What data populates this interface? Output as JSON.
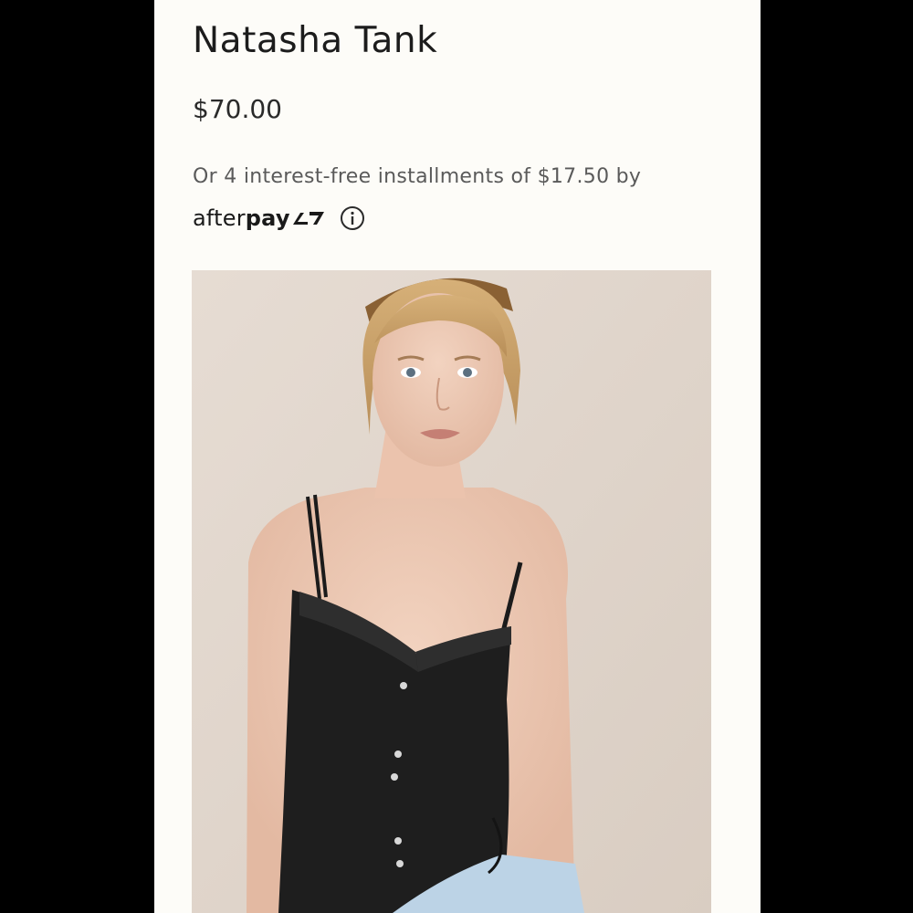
{
  "product": {
    "title": "Natasha Tank",
    "price": "$70.00",
    "installments_text": "Or 4 interest-free installments of $17.50 by",
    "afterpay": {
      "logo_light": "after",
      "logo_bold": "pay",
      "arrows_icon": "afterpay-arrows-icon",
      "info_icon": "info-circle-icon"
    },
    "image": {
      "description_icon": "product-photo"
    }
  },
  "colors": {
    "background": "#fdfcf8",
    "frame": "#000000",
    "text_dark": "#1c1c1c",
    "text_muted": "#5a5a5a"
  }
}
